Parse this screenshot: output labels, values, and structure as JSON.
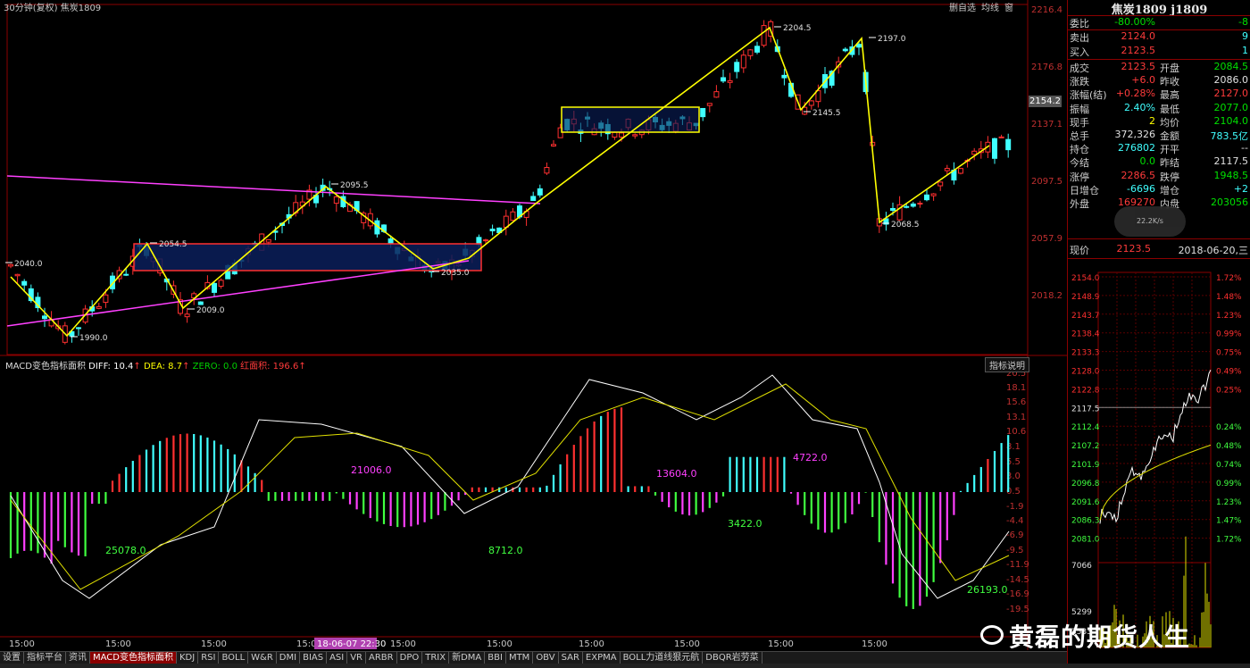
{
  "header": {
    "title": "30分钟(复权)",
    "symbol": "焦炭1809",
    "buttons": [
      "删自选",
      "均线",
      "窗"
    ]
  },
  "main_chart": {
    "price_axis": [
      "2216.4",
      "2176.8",
      "2137.1",
      "2097.5",
      "2057.9",
      "2018.2"
    ],
    "current_price_tag": "2154.2",
    "annotations": [
      "2040.0",
      "1990.0",
      "2054.5",
      "2009.0",
      "2095.5",
      "2035.0",
      "2204.5",
      "2145.5",
      "2197.0",
      "2068.5"
    ]
  },
  "macd": {
    "title": "MACD变色指标面积",
    "diff_label": "DIFF: 10.4",
    "dea_label": "DEA: 8.7",
    "zero_label": "ZERO: 0.0",
    "area_label": "红面积: 196.6",
    "indicator_btn": "指标说明",
    "axis": [
      "20.5",
      "18.1",
      "15.6",
      "13.1",
      "10.6",
      "8.1",
      "5.5",
      "3.0",
      "0.5",
      "-1.9",
      "-4.4",
      "-6.9",
      "-9.5",
      "-11.9",
      "-14.5",
      "-16.9",
      "-19.5"
    ],
    "area_values": [
      "25078.0",
      "21006.0",
      "8712.0",
      "13604.0",
      "3422.0",
      "4722.0",
      "26193.0"
    ]
  },
  "time_axis": [
    "15:00",
    "15:00",
    "15:00",
    "15:00",
    "15:00",
    "15:00",
    "15:00",
    "15:00",
    "15:00",
    "15:00"
  ],
  "cursor_time": "18-06-07 22:30",
  "tabs": [
    "设置",
    "指标平台",
    "资讯",
    "MACD变色指标面积",
    "KDJ",
    "RSI",
    "BOLL",
    "W&R",
    "DMI",
    "BIAS",
    "ASI",
    "VR",
    "ARBR",
    "DPO",
    "TRIX",
    "新DMA",
    "BBI",
    "MTM",
    "OBV",
    "SAR",
    "EXPMA",
    "BOLL力道线狠元航",
    "DBQR岩劳菜"
  ],
  "active_tab": "MACD变色指标面积",
  "quote": {
    "title": "焦炭1809 j1809",
    "weibi": {
      "label": "委比",
      "value": "-80.00%",
      "extra": "-8"
    },
    "sell": {
      "label": "卖出",
      "value": "2124.0",
      "extra": "9"
    },
    "buy": {
      "label": "买入",
      "value": "2123.5",
      "extra": "1"
    },
    "rows": [
      {
        "l": "成交",
        "v": "2123.5",
        "vc": "red",
        "l2": "开盘",
        "v2": "2084.5",
        "v2c": "grn"
      },
      {
        "l": "涨跌",
        "v": "+6.0",
        "vc": "red",
        "l2": "昨收",
        "v2": "2086.0",
        "v2c": "wht"
      },
      {
        "l": "涨幅(结)",
        "v": "+0.28%",
        "vc": "red",
        "l2": "最高",
        "v2": "2127.0",
        "v2c": "red"
      },
      {
        "l": "振幅",
        "v": "2.40%",
        "vc": "cyn",
        "l2": "最低",
        "v2": "2077.0",
        "v2c": "grn"
      },
      {
        "l": "现手",
        "v": "2",
        "vc": "yel",
        "l2": "均价",
        "v2": "2104.0",
        "v2c": "grn"
      },
      {
        "l": "总手",
        "v": "372,326",
        "vc": "wht",
        "l2": "金额",
        "v2": "783.5亿",
        "v2c": "cyn"
      },
      {
        "l": "持仓",
        "v": "276802",
        "vc": "cyn",
        "l2": "开平",
        "v2": "--",
        "v2c": "wht"
      },
      {
        "l": "今结",
        "v": "0.0",
        "vc": "grn",
        "l2": "昨结",
        "v2": "2117.5",
        "v2c": "wht"
      },
      {
        "l": "涨停",
        "v": "2286.5",
        "vc": "red",
        "l2": "跌停",
        "v2": "1948.5",
        "v2c": "grn"
      },
      {
        "l": "日增仓",
        "v": "-6696",
        "vc": "cyn",
        "l2": "增仓",
        "v2": "+2",
        "v2c": "cyn"
      },
      {
        "l": "外盘",
        "v": "169270",
        "vc": "red",
        "l2": "内盘",
        "v2": "203056",
        "v2c": "grn"
      }
    ],
    "speed_badge": "22.2K/s",
    "now_label": "现价",
    "now_price": "2123.5",
    "date": "2018-06-20,三"
  },
  "intraday": {
    "price_axis": [
      "2154.0",
      "2148.9",
      "2143.7",
      "2138.4",
      "2133.3",
      "2128.0",
      "2122.8",
      "2117.5",
      "2112.4",
      "2107.2",
      "2101.9",
      "2096.8",
      "2091.6",
      "2086.3",
      "2081.0"
    ],
    "pct_axis": [
      "1.72%",
      "1.48%",
      "1.23%",
      "0.99%",
      "0.75%",
      "0.49%",
      "0.25%",
      "0.24%",
      "0.48%",
      "0.74%",
      "0.99%",
      "1.23%",
      "1.47%",
      "1.72%"
    ],
    "vol_axis": [
      "7066",
      "5299",
      "3533"
    ]
  },
  "watermark": "黄磊的期货人生"
}
